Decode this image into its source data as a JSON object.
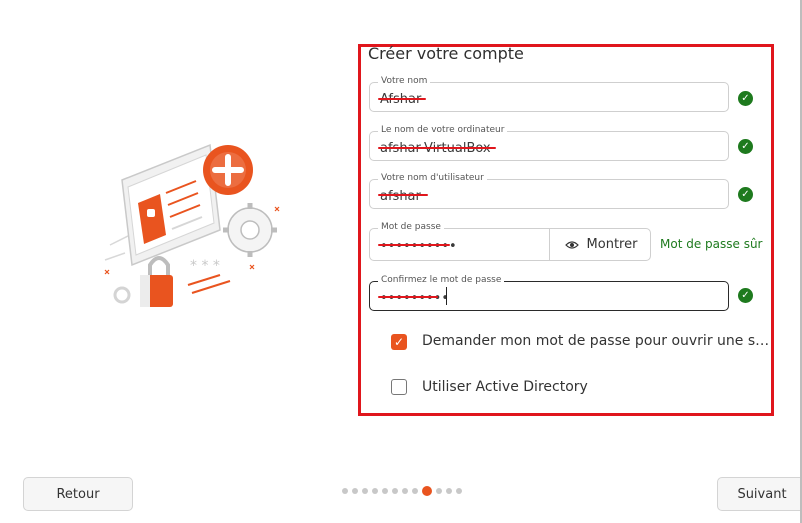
{
  "form": {
    "title": "Créer votre compte",
    "name_label": "Votre nom",
    "name_value": "Afshar",
    "computer_label": "Le nom de votre ordinateur",
    "computer_value": "afshar-VirtualBox",
    "username_label": "Votre nom d'utilisateur",
    "username_value": "afshar",
    "password_label": "Mot de passe",
    "password_value": "••••••••••",
    "show_label": "Montrer",
    "strength_text": "Mot de passe sûr",
    "confirm_label": "Confirmez le mot de passe",
    "confirm_value": "•••••••••",
    "checkbox_password_label": "Demander mon mot de passe pour ouvrir une s…",
    "checkbox_password_checked": true,
    "checkbox_ad_label": "Utiliser Active Directory",
    "checkbox_ad_checked": false
  },
  "nav": {
    "back_label": "Retour",
    "next_label": "Suivant",
    "step_total": 12,
    "step_current": 9
  },
  "colors": {
    "accent": "#e9541f",
    "valid": "#1e7a1e",
    "highlight_box": "#e0161c"
  },
  "icons": {
    "valid": "check-circle-icon",
    "show": "eye-icon",
    "checkbox": "checkmark-icon"
  }
}
